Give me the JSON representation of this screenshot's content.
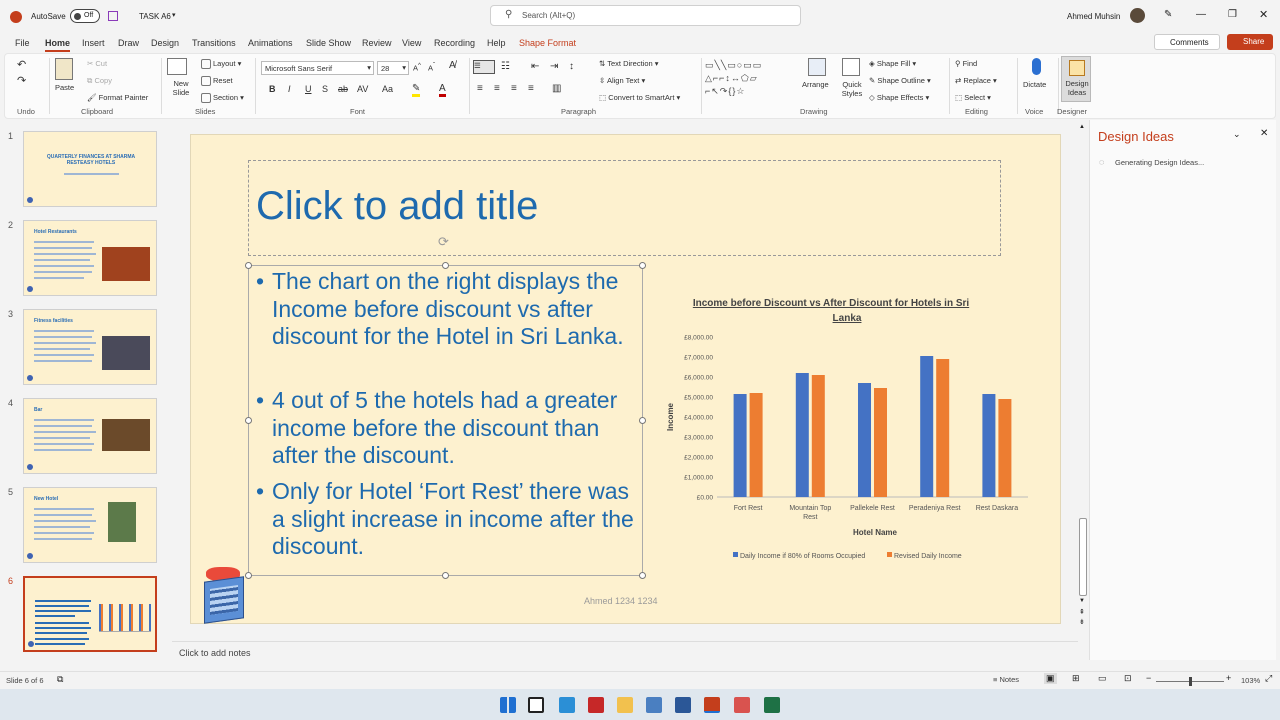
{
  "titlebar": {
    "autosave": "AutoSave",
    "toggle": "Off",
    "doc": "TASK A6",
    "search": "Search (Alt+Q)",
    "user": "Ahmed Muhsin"
  },
  "menu": {
    "tabs": [
      "File",
      "Home",
      "Insert",
      "Draw",
      "Design",
      "Transitions",
      "Animations",
      "Slide Show",
      "Review",
      "View",
      "Recording",
      "Help",
      "Shape Format"
    ],
    "comments": "Comments",
    "share": "Share"
  },
  "ribbon": {
    "undo": "Undo",
    "clipboard": {
      "paste": "Paste",
      "cut": "Cut",
      "copy": "Copy",
      "format_painter": "Format Painter",
      "label": "Clipboard"
    },
    "slides": {
      "new_slide": "New Slide",
      "layout": "Layout",
      "reset": "Reset",
      "section": "Section",
      "label": "Slides"
    },
    "font": {
      "name": "Microsoft Sans Serif",
      "size": "28",
      "label": "Font"
    },
    "paragraph": {
      "text_direction": "Text Direction",
      "align_text": "Align Text",
      "smartart": "Convert to SmartArt",
      "label": "Paragraph"
    },
    "drawing": {
      "arrange": "Arrange",
      "quick_styles": "Quick Styles",
      "shape_fill": "Shape Fill",
      "shape_outline": "Shape Outline",
      "shape_effects": "Shape Effects",
      "label": "Drawing"
    },
    "editing": {
      "find": "Find",
      "replace": "Replace",
      "select": "Select",
      "label": "Editing"
    },
    "voice": {
      "dictate": "Dictate",
      "label": "Voice"
    },
    "designer": {
      "design_ideas": "Design Ideas",
      "label": "Designer"
    }
  },
  "thumbnails": [
    {
      "num": "1",
      "title": "QUARTERLY FINANCES AT SHARMA RESTEASY HOTELS"
    },
    {
      "num": "2",
      "title": "Hotel Restaurants"
    },
    {
      "num": "3",
      "title": "Fitness facilities"
    },
    {
      "num": "4",
      "title": "Bar"
    },
    {
      "num": "5",
      "title": "New Hotel"
    },
    {
      "num": "6",
      "title": ""
    }
  ],
  "slide": {
    "title_placeholder": "Click to add title",
    "bullets": [
      "The chart on the right displays the Income before discount vs after discount for the Hotel in Sri Lanka.",
      "4 out of 5 the hotels had a greater income before the discount than after the discount.",
      "Only for Hotel ‘Fort Rest’ there was a slight increase in income after the discount."
    ],
    "footer": "Ahmed 1234 1234"
  },
  "chart_data": {
    "type": "bar",
    "title": "Income before Discount vs After Discount for Hotels in Sri Lanka",
    "xlabel": "Hotel Name",
    "ylabel": "Income",
    "categories": [
      "Fort Rest",
      "Mountain Top Rest",
      "Pallekele Rest",
      "Peradeniya Rest",
      "Rest Daskara"
    ],
    "series": [
      {
        "name": "Daily Income if 80% of Rooms Occupied",
        "values": [
          5150,
          6200,
          5700,
          7050,
          5150
        ],
        "color": "#4472c4"
      },
      {
        "name": "Revised Daily Income",
        "values": [
          5200,
          6100,
          5450,
          6900,
          4900
        ],
        "color": "#ed7d31"
      }
    ],
    "ylim": [
      0,
      8000
    ],
    "ticks": [
      "£0.00",
      "£1,000.00",
      "£2,000.00",
      "£3,000.00",
      "£4,000.00",
      "£5,000.00",
      "£6,000.00",
      "£7,000.00",
      "£8,000.00"
    ],
    "grid": false,
    "legend": "bottom"
  },
  "notes": "Click to add notes",
  "design_pane": {
    "title": "Design Ideas",
    "status": "Generating Design Ideas..."
  },
  "status": {
    "slide": "Slide 6 of 6",
    "notes": "Notes",
    "zoom": "103%"
  }
}
